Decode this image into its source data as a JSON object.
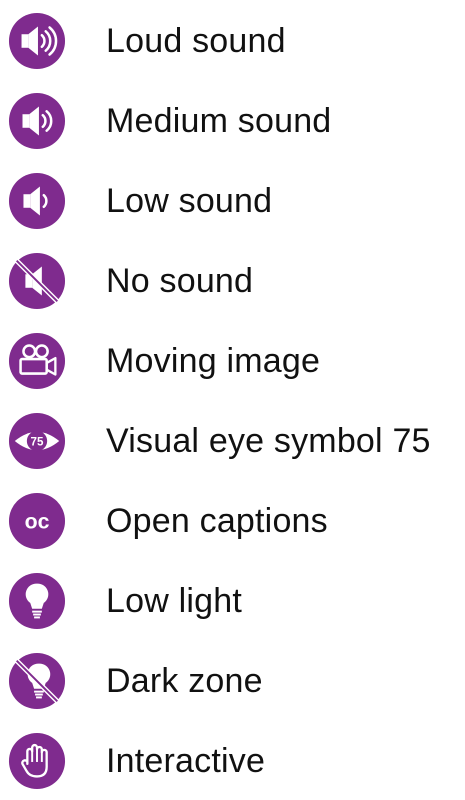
{
  "colors": {
    "icon_purple": "#7f2b8e",
    "text": "#111111",
    "background": "#ffffff"
  },
  "legend": [
    {
      "icon": "loud-sound-icon",
      "label": "Loud sound"
    },
    {
      "icon": "medium-sound-icon",
      "label": "Medium sound"
    },
    {
      "icon": "low-sound-icon",
      "label": "Low sound"
    },
    {
      "icon": "no-sound-icon",
      "label": "No sound"
    },
    {
      "icon": "moving-image-icon",
      "label": "Moving image"
    },
    {
      "icon": "visual-eye-icon",
      "label": "Visual eye symbol 75",
      "badge": "75"
    },
    {
      "icon": "open-captions-icon",
      "label": "Open captions",
      "badge": "oc"
    },
    {
      "icon": "low-light-icon",
      "label": "Low light"
    },
    {
      "icon": "dark-zone-icon",
      "label": "Dark zone"
    },
    {
      "icon": "interactive-hand-icon",
      "label": "Interactive"
    }
  ]
}
